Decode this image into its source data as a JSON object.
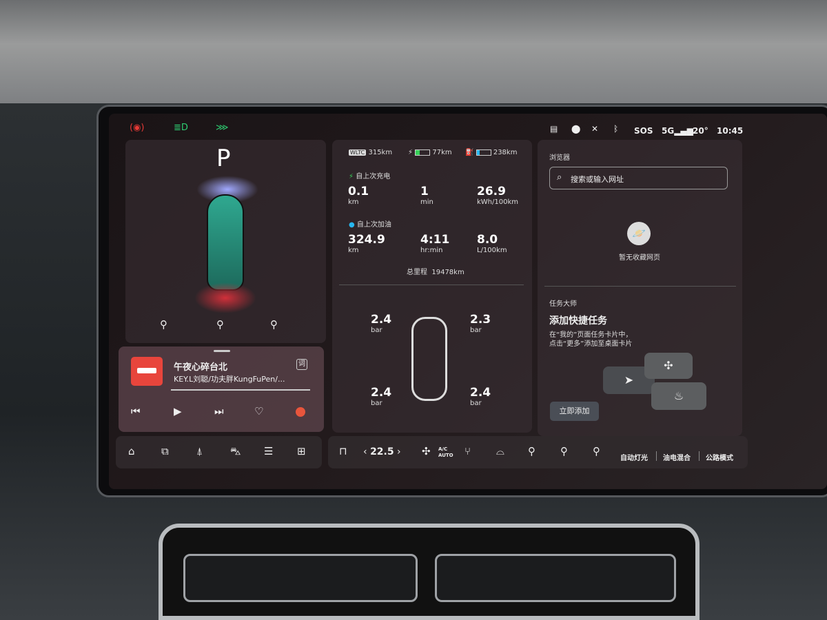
{
  "status_bar": {
    "left_icons": [
      "parking-brake-icon",
      "headlight-icon",
      "position-light-icon"
    ],
    "left_colors": [
      "#e53935",
      "#2ecc71",
      "#2ecc71"
    ],
    "right": {
      "sos": "SOS",
      "network": "5G",
      "temperature": "20°",
      "time": "10:45"
    }
  },
  "vehicle": {
    "gear": "P",
    "actions": [
      "door-icon",
      "trunk-icon",
      "charge-port-icon"
    ]
  },
  "music": {
    "title": "午夜心碎台北",
    "artist": "KEY.L刘聪/功夫胖KungFuPen/...",
    "lyrics_button": "词",
    "accent": "#e8453c"
  },
  "trip": {
    "ranges": [
      {
        "badge": "WLTC",
        "value": "315km"
      },
      {
        "value": "77km",
        "level": 0.3,
        "color": "#37d058"
      },
      {
        "value": "238km",
        "level": 0.2,
        "color": "#27b7f0"
      }
    ],
    "since_charge": {
      "label": "自上次充电",
      "items": [
        {
          "value": "0.1",
          "unit": "km"
        },
        {
          "value": "1",
          "unit": "min"
        },
        {
          "value": "26.9",
          "unit": "kWh/100km"
        }
      ]
    },
    "since_refuel": {
      "label": "自上次加油",
      "items": [
        {
          "value": "324.9",
          "unit": "km"
        },
        {
          "value": "4:11",
          "unit": "hr:min"
        },
        {
          "value": "8.0",
          "unit": "L/100km"
        }
      ]
    },
    "odometer_label": "总里程",
    "odometer": "19478km"
  },
  "tires": [
    {
      "value": "2.4",
      "unit": "bar"
    },
    {
      "value": "2.3",
      "unit": "bar"
    },
    {
      "value": "2.4",
      "unit": "bar"
    },
    {
      "value": "2.4",
      "unit": "bar"
    }
  ],
  "browser": {
    "title": "浏览器",
    "search_placeholder": "搜索或输入网址",
    "empty": "暂无收藏网页"
  },
  "task": {
    "title": "任务大师",
    "heading": "添加快捷任务",
    "line1": "在“我的”页面任务卡片中，",
    "line2": "点击“更多”添加至桌面卡片",
    "button": "立即添加"
  },
  "dock_left": [
    "home-icon",
    "apps-icon",
    "navigation-icon",
    "car-icon",
    "media-icon",
    "grid-icon"
  ],
  "dock_right": {
    "temp": "22.5",
    "ac": "A/C",
    "auto": "AUTO",
    "auto_light": "自动灯光",
    "mode1": "油电混合",
    "mode2": "公路模式"
  }
}
